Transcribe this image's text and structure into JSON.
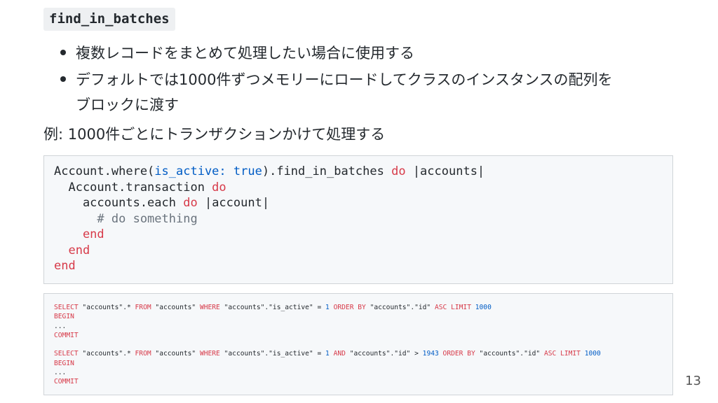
{
  "slide": {
    "title": "find_in_batches",
    "bullets": [
      "複数レコードをまとめて処理したい場合に使用する",
      "デフォルトでは1000件ずつメモリーにロードしてクラスのインスタンスの配列を",
      "ブロックに渡す"
    ],
    "example": "例: 1000件ごとにトランザクションかけて処理する",
    "page_number": "13"
  },
  "code1": {
    "l1_a": "Account.where(",
    "l1_b": "is_active:",
    "l1_c": " ",
    "l1_d": "true",
    "l1_e": ").find_in_batches ",
    "l1_f": "do",
    "l1_g": " |accounts|",
    "l2_a": "  Account.transaction ",
    "l2_b": "do",
    "l3_a": "    accounts.each ",
    "l3_b": "do",
    "l3_c": " |account|",
    "l4": "      # do something",
    "l5": "    end",
    "l6": "  end",
    "l7": "end"
  },
  "code2": {
    "q1_select": "SELECT",
    "q1_a": " \"accounts\".* ",
    "q1_from": "FROM",
    "q1_b": " \"accounts\" ",
    "q1_where": "WHERE",
    "q1_c": " \"accounts\".\"is_active\" = ",
    "q1_one": "1",
    "q1_orderby": " ORDER BY",
    "q1_d": " \"accounts\".\"id\" ",
    "q1_asc": "ASC LIMIT",
    "q1_lim": " 1000",
    "begin": "BEGIN",
    "dots": "...",
    "commit": "COMMIT",
    "q2_select": "SELECT",
    "q2_a": " \"accounts\".* ",
    "q2_from": "FROM",
    "q2_b": " \"accounts\" ",
    "q2_where": "WHERE",
    "q2_c": " \"accounts\".\"is_active\" = ",
    "q2_one": "1",
    "q2_and": " AND",
    "q2_d": " \"accounts\".\"id\" > ",
    "q2_num": "1943",
    "q2_orderby": " ORDER BY",
    "q2_e": " \"accounts\".\"id\" ",
    "q2_asc": "ASC LIMIT",
    "q2_lim": " 1000"
  },
  "colors": {
    "keyword": "#d73a49",
    "attribute": "#005cc5",
    "comment": "#6a737d",
    "code_background": "#f6f8fa"
  }
}
